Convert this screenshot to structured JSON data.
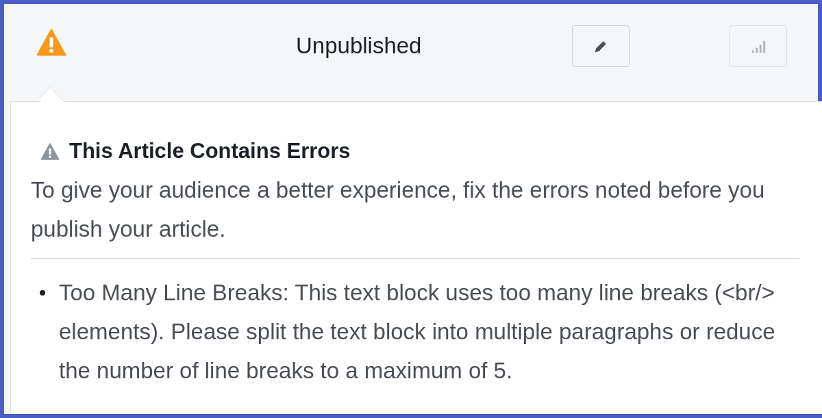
{
  "header": {
    "status": "Unpublished",
    "buttons": [
      {
        "kind": "edit",
        "disabled": false
      },
      {
        "kind": "stats",
        "disabled": true
      }
    ]
  },
  "popover": {
    "title": "This Article Contains Errors",
    "message": "To give your audience a better experience, fix the errors noted before you publish your article.",
    "errors": [
      "Too Many Line Breaks: This text block uses too many line breaks (<br/> elements). Please split the text block into multiple paragraphs or reduce the number of line breaks to a maximum of 5."
    ]
  }
}
